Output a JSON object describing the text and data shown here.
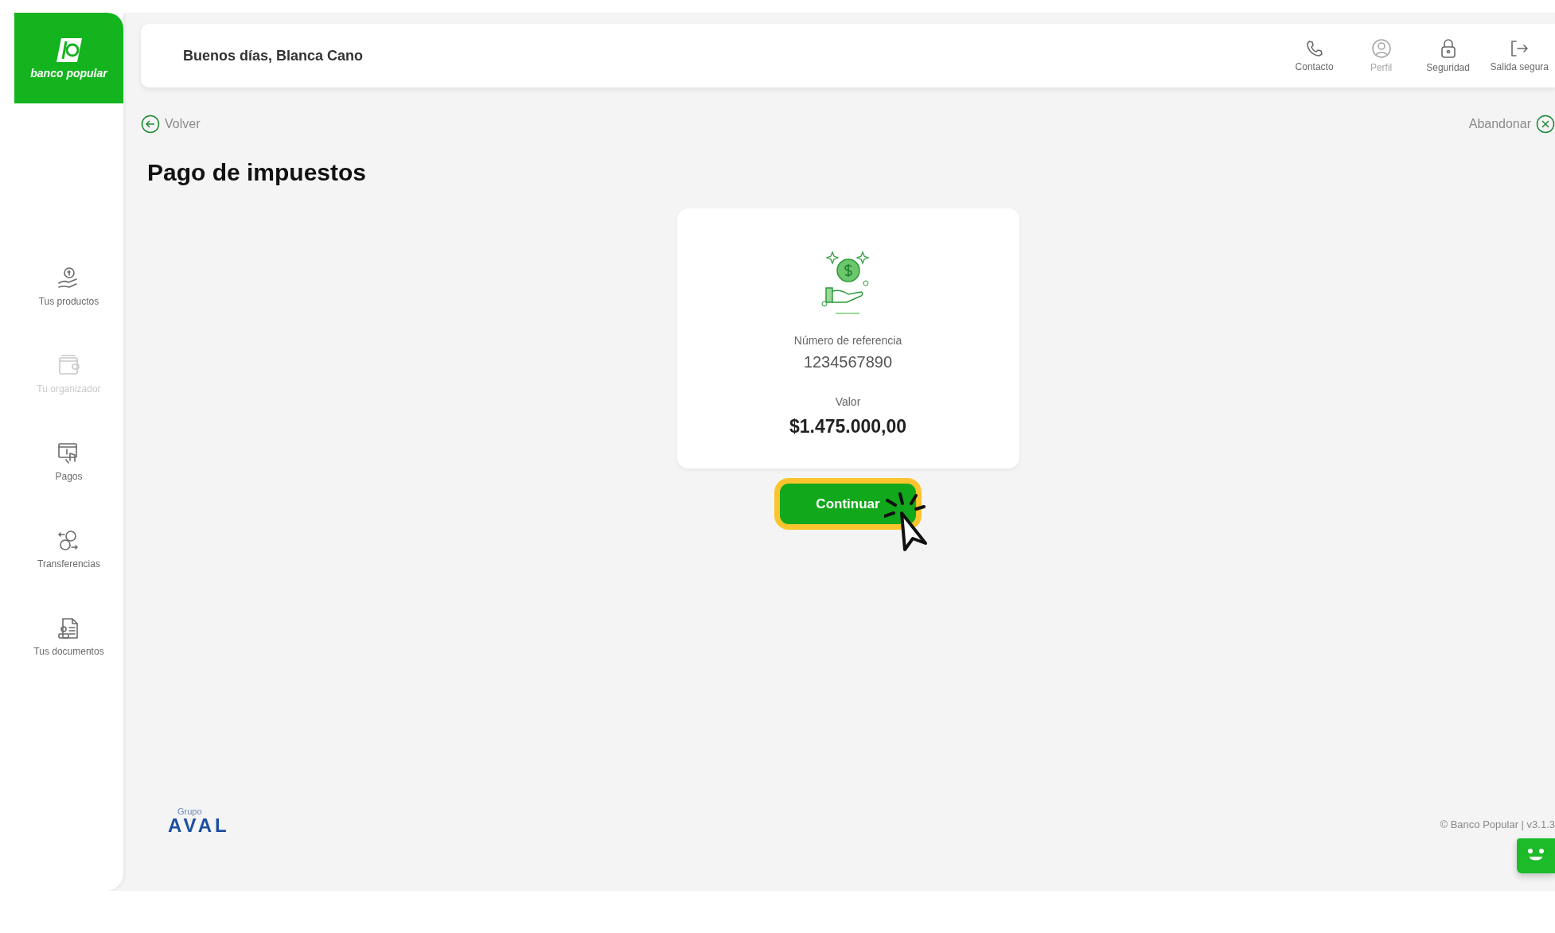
{
  "logo": {
    "wordmark": "banco popular"
  },
  "sidebar": {
    "items": [
      {
        "label": "Tus productos",
        "disabled": false
      },
      {
        "label": "Tu organizador",
        "disabled": true
      },
      {
        "label": "Pagos",
        "disabled": false
      },
      {
        "label": "Transferencias",
        "disabled": false
      },
      {
        "label": "Tus documentos",
        "disabled": false
      }
    ]
  },
  "header": {
    "greeting": "Buenos días, Blanca Cano",
    "actions": [
      {
        "label": "Contacto",
        "disabled": false
      },
      {
        "label": "Perfil",
        "disabled": true
      },
      {
        "label": "Seguridad",
        "disabled": false
      },
      {
        "label": "Salida segura",
        "disabled": false
      }
    ]
  },
  "back_link": "Volver",
  "abandon_link": "Abandonar",
  "title": "Pago de impuestos",
  "summary": {
    "reference_label": "Número de referencia",
    "reference": "1234567890",
    "amount_label": "Valor",
    "amount": "$1.475.000,00"
  },
  "continue_button": {
    "label": "Continuar",
    "highlighted": true
  },
  "footer": {
    "partner_small": "Grupo",
    "partner_name": "AVAL",
    "copyright": "© Banco Popular | v3.1.3"
  }
}
